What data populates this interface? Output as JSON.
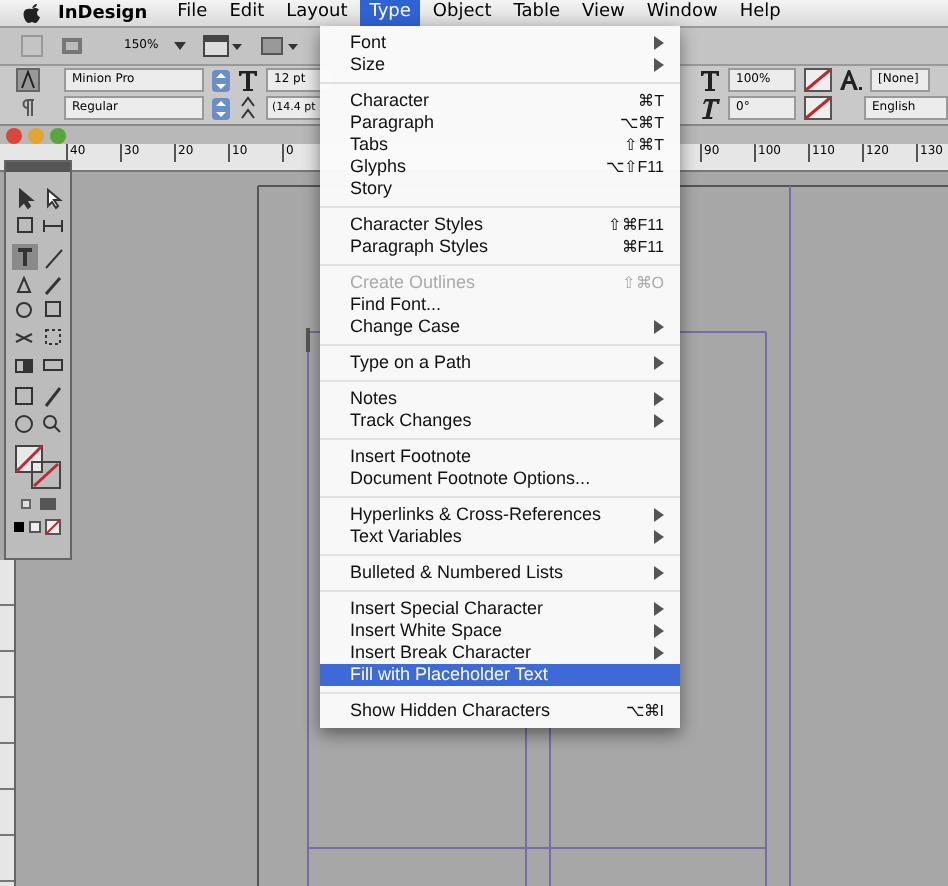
{
  "menu_bar": {
    "app": "InDesign",
    "items": [
      {
        "label": "File",
        "selected": false
      },
      {
        "label": "Edit",
        "selected": false
      },
      {
        "label": "Layout",
        "selected": false
      },
      {
        "label": "Type",
        "selected": true
      },
      {
        "label": "Object",
        "selected": false
      },
      {
        "label": "Table",
        "selected": false
      },
      {
        "label": "View",
        "selected": false
      },
      {
        "label": "Window",
        "selected": false
      },
      {
        "label": "Help",
        "selected": false
      }
    ]
  },
  "toolbar": {
    "zoom": "150%"
  },
  "control_panel": {
    "font_family": "Minion Pro",
    "font_style": "Regular",
    "font_size": "12 pt",
    "leading": "(14.4 pt",
    "scale": "100%",
    "skew": "0°",
    "style": "[None]",
    "language": "English"
  },
  "ruler": {
    "left_labels": [
      "40",
      "30",
      "20",
      "10",
      "0"
    ],
    "right_labels": [
      "90",
      "100",
      "110",
      "120",
      "130"
    ]
  },
  "type_menu": [
    {
      "kind": "item",
      "label": "Font",
      "submenu": true
    },
    {
      "kind": "item",
      "label": "Size",
      "submenu": true
    },
    {
      "kind": "separator"
    },
    {
      "kind": "item",
      "label": "Character",
      "shortcut": "⌘T"
    },
    {
      "kind": "item",
      "label": "Paragraph",
      "shortcut": "⌥⌘T"
    },
    {
      "kind": "item",
      "label": "Tabs",
      "shortcut": "⇧⌘T"
    },
    {
      "kind": "item",
      "label": "Glyphs",
      "shortcut": "⌥⇧F11"
    },
    {
      "kind": "item",
      "label": "Story"
    },
    {
      "kind": "separator"
    },
    {
      "kind": "item",
      "label": "Character Styles",
      "shortcut": "⇧⌘F11"
    },
    {
      "kind": "item",
      "label": "Paragraph Styles",
      "shortcut": "⌘F11"
    },
    {
      "kind": "separator"
    },
    {
      "kind": "item",
      "label": "Create Outlines",
      "shortcut": "⇧⌘O",
      "disabled": true
    },
    {
      "kind": "item",
      "label": "Find Font..."
    },
    {
      "kind": "item",
      "label": "Change Case",
      "submenu": true
    },
    {
      "kind": "separator"
    },
    {
      "kind": "item",
      "label": "Type on a Path",
      "submenu": true
    },
    {
      "kind": "separator"
    },
    {
      "kind": "item",
      "label": "Notes",
      "submenu": true
    },
    {
      "kind": "item",
      "label": "Track Changes",
      "submenu": true
    },
    {
      "kind": "separator"
    },
    {
      "kind": "item",
      "label": "Insert Footnote"
    },
    {
      "kind": "item",
      "label": "Document Footnote Options..."
    },
    {
      "kind": "separator"
    },
    {
      "kind": "item",
      "label": "Hyperlinks & Cross-References",
      "submenu": true
    },
    {
      "kind": "item",
      "label": "Text Variables",
      "submenu": true
    },
    {
      "kind": "separator"
    },
    {
      "kind": "item",
      "label": "Bulleted & Numbered Lists",
      "submenu": true
    },
    {
      "kind": "separator"
    },
    {
      "kind": "item",
      "label": "Insert Special Character",
      "submenu": true
    },
    {
      "kind": "item",
      "label": "Insert White Space",
      "submenu": true
    },
    {
      "kind": "item",
      "label": "Insert Break Character",
      "submenu": true
    },
    {
      "kind": "item",
      "label": "Fill with Placeholder Text",
      "selected": true
    },
    {
      "kind": "separator"
    },
    {
      "kind": "item",
      "label": "Show Hidden Characters",
      "shortcut": "⌥⌘I"
    }
  ]
}
